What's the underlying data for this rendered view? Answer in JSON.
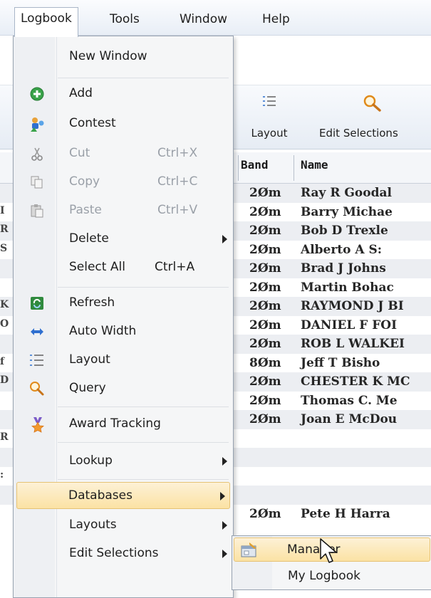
{
  "menubar": {
    "items": [
      "Logbook",
      "Tools",
      "Window",
      "Help"
    ]
  },
  "ribbon": {
    "layout_label": "Layout",
    "edit_selections_label": "Edit Selections"
  },
  "grid": {
    "columns": [
      "Band",
      "Name"
    ],
    "rows": [
      {
        "left": "",
        "band": "2Øm",
        "name": "Ray R Goodal"
      },
      {
        "left": "I",
        "band": "2Øm",
        "name": "Barry Michae"
      },
      {
        "left": "R",
        "band": "2Øm",
        "name": "Bob D Trexle"
      },
      {
        "left": "S",
        "band": "2Øm",
        "name": "Alberto A S:"
      },
      {
        "left": "",
        "band": "2Øm",
        "name": "Brad J Johns"
      },
      {
        "left": "",
        "band": "2Øm",
        "name": "Martin Bohac"
      },
      {
        "left": "K",
        "band": "2Øm",
        "name": "RAYMOND J BI"
      },
      {
        "left": "O",
        "band": "2Øm",
        "name": "DANIEL F FOI"
      },
      {
        "left": "",
        "band": "2Øm",
        "name": "ROB L WALKEI"
      },
      {
        "left": "f",
        "band": "8Øm",
        "name": "Jeff T Bisho"
      },
      {
        "left": "D",
        "band": "2Øm",
        "name": "CHESTER K MC"
      },
      {
        "left": "",
        "band": "2Øm",
        "name": "Thomas C. Me"
      },
      {
        "left": "",
        "band": "2Øm",
        "name": "Joan E McDou"
      },
      {
        "left": "R",
        "band": "",
        "name": ""
      },
      {
        "left": "",
        "band": "",
        "name": ""
      },
      {
        "left": ":",
        "band": "",
        "name": ""
      },
      {
        "left": "",
        "band": "",
        "name": ""
      },
      {
        "left": "",
        "band": "2Øm",
        "name": "Pete H Harra"
      }
    ]
  },
  "menu": {
    "new_window": "New Window",
    "add": "Add",
    "contest": "Contest",
    "cut": "Cut",
    "cut_shortcut": "Ctrl+X",
    "copy": "Copy",
    "copy_shortcut": "Ctrl+C",
    "paste": "Paste",
    "paste_shortcut": "Ctrl+V",
    "delete": "Delete",
    "select_all": "Select All",
    "select_all_shortcut": "Ctrl+A",
    "refresh": "Refresh",
    "auto_width": "Auto Width",
    "layout": "Layout",
    "query": "Query",
    "award_tracking": "Award Tracking",
    "lookup": "Lookup",
    "databases": "Databases",
    "layouts": "Layouts",
    "edit_selections": "Edit Selections"
  },
  "submenu": {
    "manager": "Manager",
    "my_logbook": "My Logbook"
  },
  "icons": {
    "add": "add-icon",
    "contest": "contest-icon",
    "cut": "scissors-icon",
    "copy": "copy-icon",
    "paste": "paste-icon",
    "refresh": "refresh-icon",
    "auto_width": "auto-width-icon",
    "layout": "layout-icon",
    "query": "query-icon",
    "award": "award-icon",
    "manager": "database-manager-icon"
  },
  "colors": {
    "highlight": "#fbe2a4",
    "menu_bg": "#f5f6f7",
    "accent_blue": "#2f6fd0"
  }
}
